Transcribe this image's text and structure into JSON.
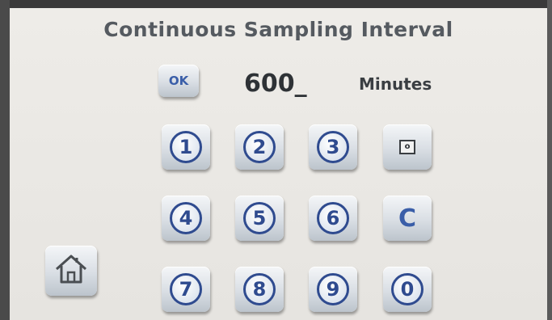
{
  "screen": {
    "title": "Continuous Sampling Interval"
  },
  "entry": {
    "ok_label": "OK",
    "value": "600_",
    "unit": "Minutes"
  },
  "keypad": {
    "keys": [
      {
        "label": "1"
      },
      {
        "label": "2"
      },
      {
        "label": "3"
      },
      {
        "label": "o"
      },
      {
        "label": "4"
      },
      {
        "label": "5"
      },
      {
        "label": "6"
      },
      {
        "label": "C"
      },
      {
        "label": "7"
      },
      {
        "label": "8"
      },
      {
        "label": "9"
      },
      {
        "label": "0"
      }
    ]
  },
  "nav": {
    "home_icon": "home-icon"
  },
  "colors": {
    "digit": "#2f4b8f",
    "title": "#555a60",
    "screen_bg": "#eae8e4"
  }
}
